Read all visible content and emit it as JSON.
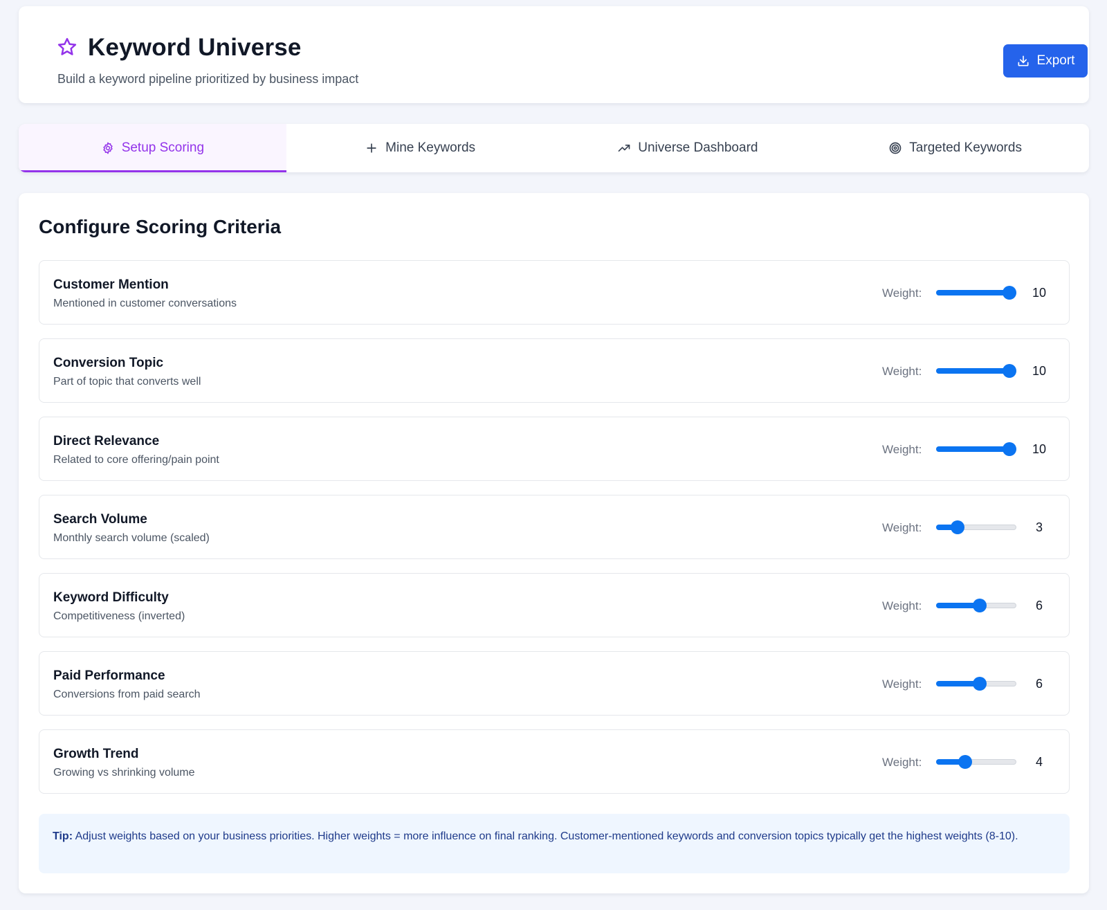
{
  "header": {
    "title": "Keyword Universe",
    "subtitle": "Build a keyword pipeline prioritized by business impact",
    "export_label": "Export",
    "icon": "star-icon",
    "accent_color": "#9333ea"
  },
  "tabs": [
    {
      "label": "Setup Scoring",
      "icon": "gear-icon",
      "active": true
    },
    {
      "label": "Mine Keywords",
      "icon": "plus-icon",
      "active": false
    },
    {
      "label": "Universe Dashboard",
      "icon": "trending-up-icon",
      "active": false
    },
    {
      "label": "Targeted Keywords",
      "icon": "target-icon",
      "active": false
    }
  ],
  "main": {
    "heading": "Configure Scoring Criteria",
    "weight_label": "Weight:",
    "weight_max": 10,
    "criteria": [
      {
        "name": "Customer Mention",
        "description": "Mentioned in customer conversations",
        "weight": 10
      },
      {
        "name": "Conversion Topic",
        "description": "Part of topic that converts well",
        "weight": 10
      },
      {
        "name": "Direct Relevance",
        "description": "Related to core offering/pain point",
        "weight": 10
      },
      {
        "name": "Search Volume",
        "description": "Monthly search volume (scaled)",
        "weight": 3
      },
      {
        "name": "Keyword Difficulty",
        "description": "Competitiveness (inverted)",
        "weight": 6
      },
      {
        "name": "Paid Performance",
        "description": "Conversions from paid search",
        "weight": 6
      },
      {
        "name": "Growth Trend",
        "description": "Growing vs shrinking volume",
        "weight": 4
      }
    ],
    "tip_label": "Tip:",
    "tip_text": "Adjust weights based on your business priorities. Higher weights = more influence on final ranking. Customer-mentioned keywords and conversion topics typically get the highest weights (8-10)."
  }
}
